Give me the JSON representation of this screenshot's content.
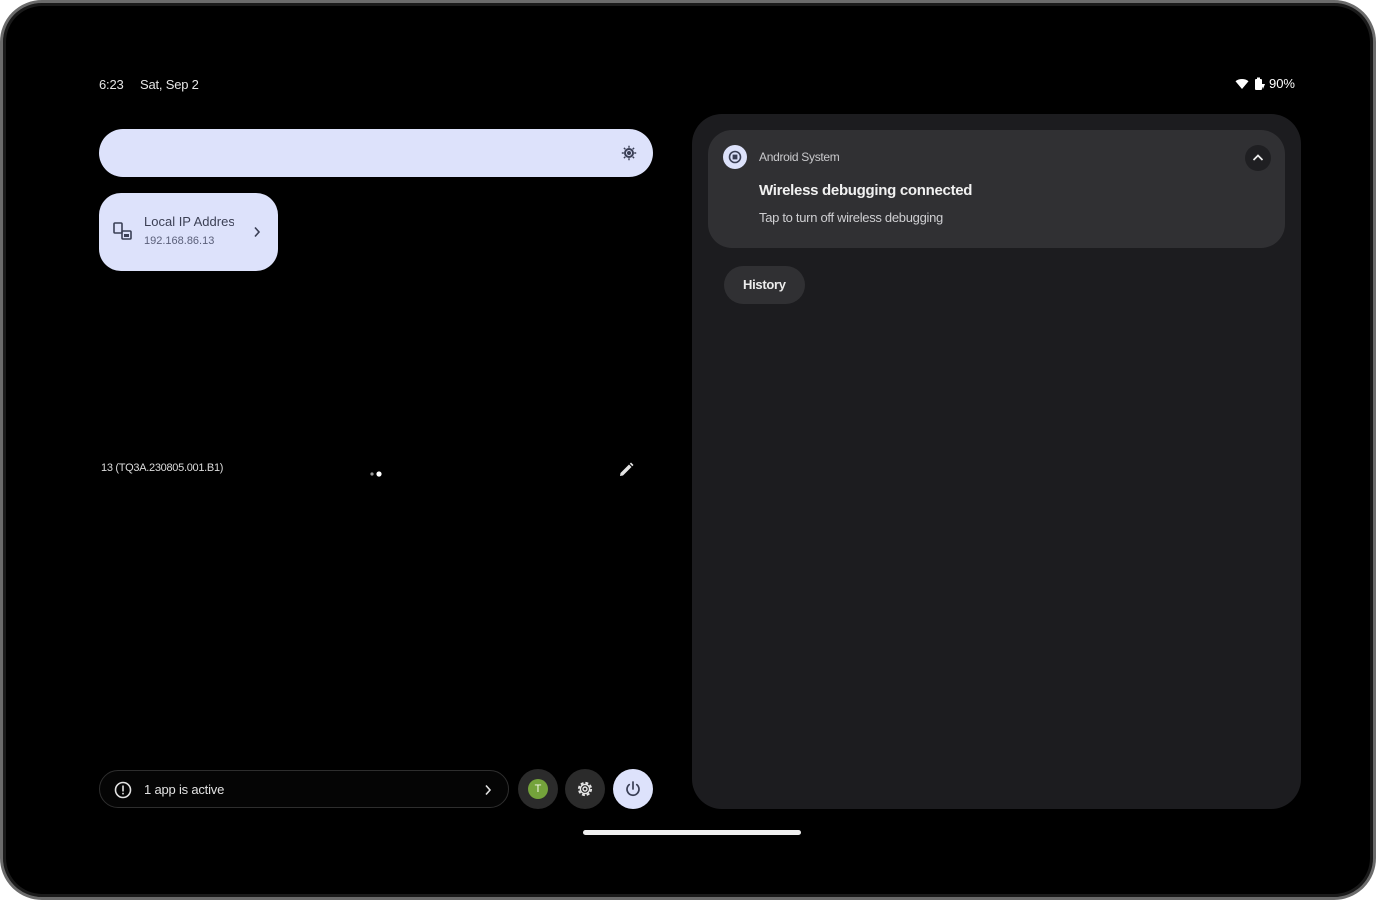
{
  "status_bar": {
    "time": "6:23",
    "date": "Sat, Sep 2",
    "battery": "90%",
    "icons": [
      "wifi-icon",
      "battery-icon"
    ]
  },
  "quick_settings": {
    "brightness": {
      "icon": "brightness-icon",
      "level": 1.0
    },
    "tiles": [
      {
        "title": "Local IP Address",
        "subtitle": "192.168.86.13",
        "icon": "network-icon"
      }
    ],
    "build_number": "13 (TQ3A.230805.001.B1)",
    "edit_icon": "edit-icon",
    "page_dots_icon": "page-dots-icon"
  },
  "footer": {
    "active_apps_label": "1 app is active",
    "user_initial": "T",
    "colors": {
      "user_avatar": "#74a33b",
      "tile_bg": "#dde2fb"
    }
  },
  "notifications": [
    {
      "app": "Android System",
      "title": "Wireless debugging connected",
      "text": "Tap to turn off wireless debugging"
    }
  ],
  "history_button": "History"
}
